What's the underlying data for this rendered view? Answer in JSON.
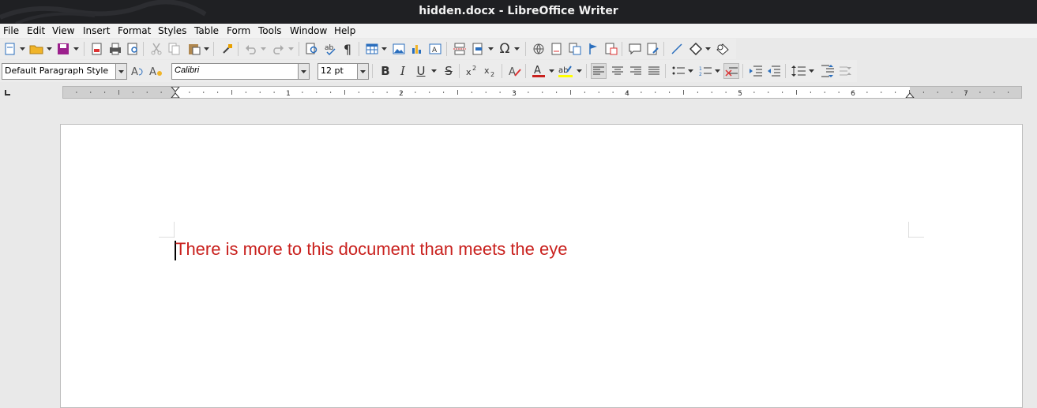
{
  "window": {
    "title": "hidden.docx - LibreOffice Writer"
  },
  "menu": [
    "File",
    "Edit",
    "View",
    "Insert",
    "Format",
    "Styles",
    "Table",
    "Form",
    "Tools",
    "Window",
    "Help"
  ],
  "sidebar_formatting": {
    "paragraph_style": "Default Paragraph Style",
    "font_name": "Calibri",
    "font_size": "12 pt"
  },
  "ruler": {
    "labels": [
      "1",
      "2",
      "3",
      "4",
      "5",
      "6",
      "7"
    ]
  },
  "document": {
    "text": "There is more to this document than meets the eye",
    "text_color": "#c9211e"
  },
  "colors": {
    "titlebar": "#1f2023",
    "font_color_swatch": "#c9211e",
    "highlight_swatch": "#ffff00"
  }
}
